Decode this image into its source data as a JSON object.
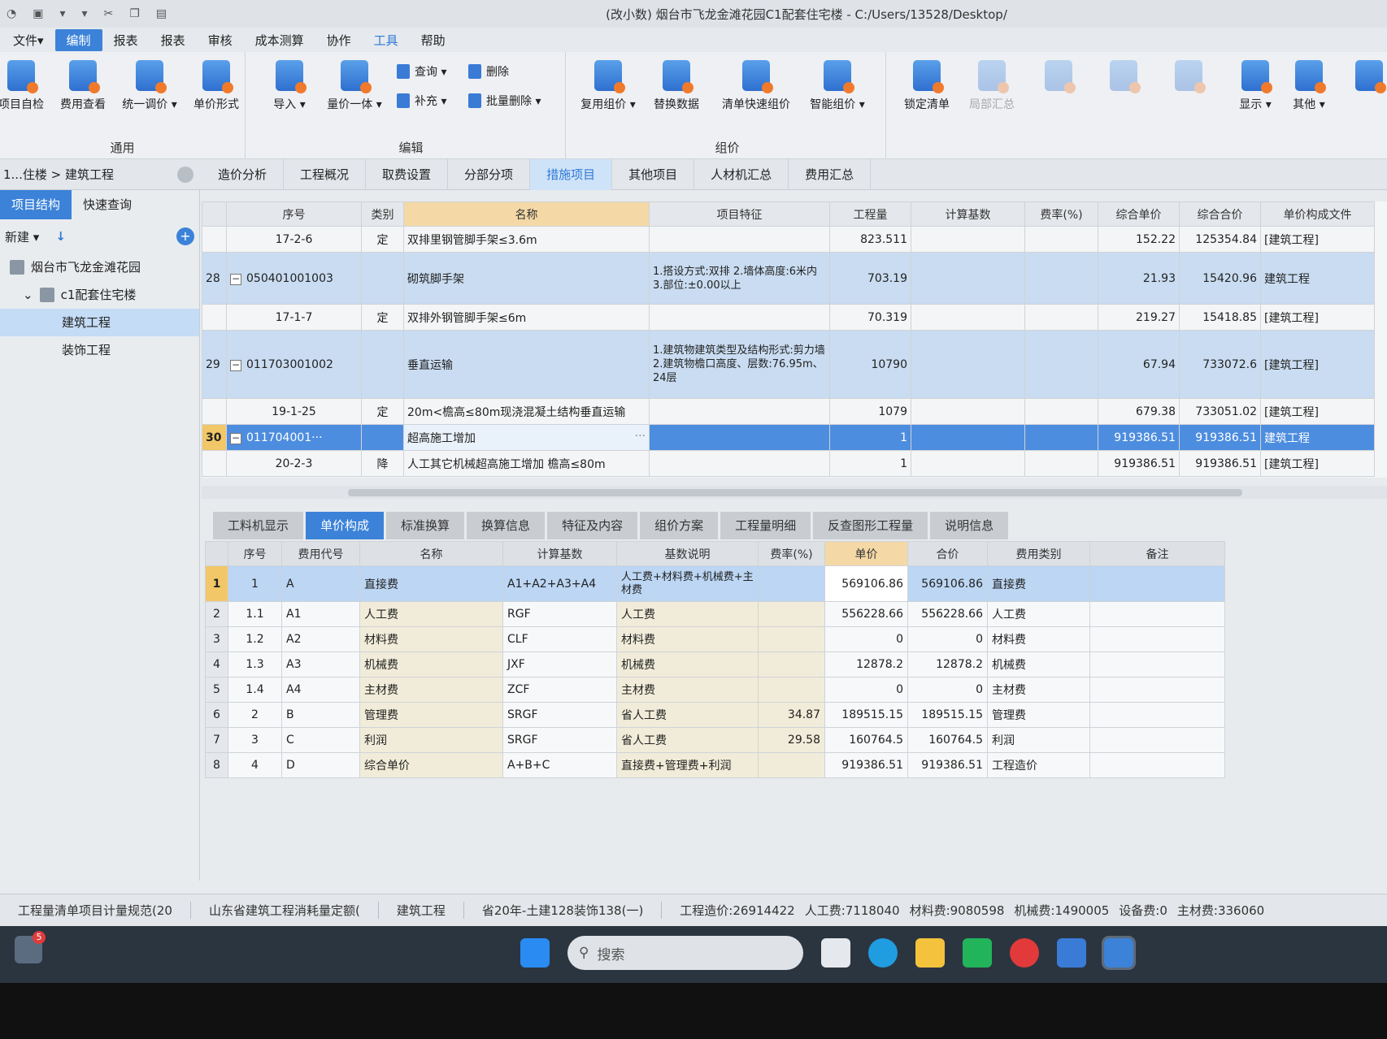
{
  "titlebar": {
    "title": "(改小数) 烟台市飞龙金滩花园C1配套住宅楼 - C:/Users/13528/Desktop/"
  },
  "menu": [
    "文件▾",
    "编制",
    "报表",
    "报表",
    "审核",
    "成本测算",
    "协作",
    "工具",
    "帮助"
  ],
  "ribbon": {
    "group_general": "通用",
    "group_edit": "编辑",
    "group_price": "组价",
    "btn_check": "项目自检",
    "btn_fee": "费用查看",
    "btn_adjust": "统一调价 ▾",
    "btn_unitprice": "单价形式",
    "btn_import": "导入 ▾",
    "btn_qtyprice": "量价一体 ▾",
    "btn_query": "查询 ▾",
    "btn_supplement": "补充 ▾",
    "btn_delete": "删除",
    "btn_batchdelete": "批量删除 ▾",
    "btn_reuse": "复用组价 ▾",
    "btn_replace": "替换数据",
    "btn_quickprice": "清单快速组价",
    "btn_smart": "智能组价 ▾",
    "btn_lock": "锁定清单",
    "btn_local": "局部汇总",
    "btn_other": "其他 ▾",
    "btn_display": "显示 ▾"
  },
  "breadcrumb": "1...住楼 > 建筑工程",
  "tabs": [
    "造价分析",
    "工程概况",
    "取费设置",
    "分部分项",
    "措施项目",
    "其他项目",
    "人材机汇总",
    "费用汇总"
  ],
  "sidebar": {
    "tab_struct": "项目结构",
    "tab_query": "快速查询",
    "new_label": "新建 ▾",
    "project": "烟台市飞龙金滩花园",
    "building": "c1配套住宅楼",
    "unit_building": "建筑工程",
    "unit_decoration": "装饰工程"
  },
  "upper_table": {
    "headers": [
      "序号",
      "类别",
      "名称",
      "项目特征",
      "工程量",
      "计算基数",
      "费率(%)",
      "综合单价",
      "综合合价",
      "单价构成文件"
    ],
    "rows": [
      {
        "num": "",
        "code": "17-2-6",
        "type": "定",
        "name": "双排里钢管脚手架≤3.6m",
        "feature": "",
        "qty": "823.511",
        "price": "152.22",
        "total": "125354.84",
        "file": "[建筑工程]"
      },
      {
        "num": "28",
        "code": "050401001003",
        "type": "",
        "name": "砌筑脚手架",
        "feature": "1.搭设方式:双排 2.墙体高度:6米内 3.部位:±0.00以上",
        "qty": "703.19",
        "price": "21.93",
        "total": "15420.96",
        "file": "建筑工程"
      },
      {
        "num": "",
        "code": "17-1-7",
        "type": "定",
        "name": "双排外钢管脚手架≤6m",
        "feature": "",
        "qty": "70.319",
        "price": "219.27",
        "total": "15418.85",
        "file": "[建筑工程]"
      },
      {
        "num": "29",
        "code": "011703001002",
        "type": "",
        "name": "垂直运输",
        "feature": "1.建筑物建筑类型及结构形式:剪力墙 2.建筑物檐口高度、层数:76.95m、24层",
        "qty": "10790",
        "price": "67.94",
        "total": "733072.6",
        "file": "[建筑工程]"
      },
      {
        "num": "",
        "code": "19-1-25",
        "type": "定",
        "name": "20m<檐高≤80m现浇混凝土结构垂直运输",
        "feature": "",
        "qty": "1079",
        "price": "679.38",
        "total": "733051.02",
        "file": "[建筑工程]"
      },
      {
        "num": "30",
        "code": "011704001···",
        "type": "",
        "name": "超高施工增加",
        "feature": "",
        "qty": "1",
        "price": "919386.51",
        "total": "919386.51",
        "file": "建筑工程"
      },
      {
        "num": "",
        "code": "20-2-3",
        "type": "降",
        "name": "人工其它机械超高施工增加 檐高≤80m",
        "feature": "",
        "qty": "1",
        "price": "919386.51",
        "total": "919386.51",
        "file": "[建筑工程]"
      }
    ]
  },
  "lower_tabs": [
    "工料机显示",
    "单价构成",
    "标准换算",
    "换算信息",
    "特征及内容",
    "组价方案",
    "工程量明细",
    "反查图形工程量",
    "说明信息"
  ],
  "lower_table": {
    "headers": [
      "",
      "序号",
      "费用代号",
      "名称",
      "计算基数",
      "基数说明",
      "费率(%)",
      "单价",
      "合价",
      "费用类别",
      "备注"
    ],
    "rows": [
      {
        "rn": "1",
        "seq": "1",
        "code": "A",
        "name": "直接费",
        "base": "A1+A2+A3+A4",
        "desc": "人工费+材料费+机械费+主材费",
        "rate": "",
        "unit": "569106.86",
        "total": "569106.86",
        "cat": "直接费"
      },
      {
        "rn": "2",
        "seq": "1.1",
        "code": "A1",
        "name": "人工费",
        "base": "RGF",
        "desc": "人工费",
        "rate": "",
        "unit": "556228.66",
        "total": "556228.66",
        "cat": "人工费"
      },
      {
        "rn": "3",
        "seq": "1.2",
        "code": "A2",
        "name": "材料费",
        "base": "CLF",
        "desc": "材料费",
        "rate": "",
        "unit": "0",
        "total": "0",
        "cat": "材料费"
      },
      {
        "rn": "4",
        "seq": "1.3",
        "code": "A3",
        "name": "机械费",
        "base": "JXF",
        "desc": "机械费",
        "rate": "",
        "unit": "12878.2",
        "total": "12878.2",
        "cat": "机械费"
      },
      {
        "rn": "5",
        "seq": "1.4",
        "code": "A4",
        "name": "主材费",
        "base": "ZCF",
        "desc": "主材费",
        "rate": "",
        "unit": "0",
        "total": "0",
        "cat": "主材费"
      },
      {
        "rn": "6",
        "seq": "2",
        "code": "B",
        "name": "管理费",
        "base": "SRGF",
        "desc": "省人工费",
        "rate": "34.87",
        "unit": "189515.15",
        "total": "189515.15",
        "cat": "管理费"
      },
      {
        "rn": "7",
        "seq": "3",
        "code": "C",
        "name": "利润",
        "base": "SRGF",
        "desc": "省人工费",
        "rate": "29.58",
        "unit": "160764.5",
        "total": "160764.5",
        "cat": "利润"
      },
      {
        "rn": "8",
        "seq": "4",
        "code": "D",
        "name": "综合单价",
        "base": "A+B+C",
        "desc": "直接费+管理费+利润",
        "rate": "",
        "unit": "919386.51",
        "total": "919386.51",
        "cat": "工程造价"
      }
    ]
  },
  "statusbar": {
    "s1": "工程量清单项目计量规范(20",
    "s2": "山东省建筑工程消耗量定额(",
    "s3": "建筑工程",
    "s4": "省20年-土建128装饰138(一)",
    "s5": "工程造价:26914422",
    "s6": "人工费:7118040",
    "s7": "材料费:9080598",
    "s8": "机械费:1490005",
    "s9": "设备费:0",
    "s10": "主材费:336060"
  },
  "taskbar": {
    "search_placeholder": "搜索",
    "badge": "5"
  }
}
